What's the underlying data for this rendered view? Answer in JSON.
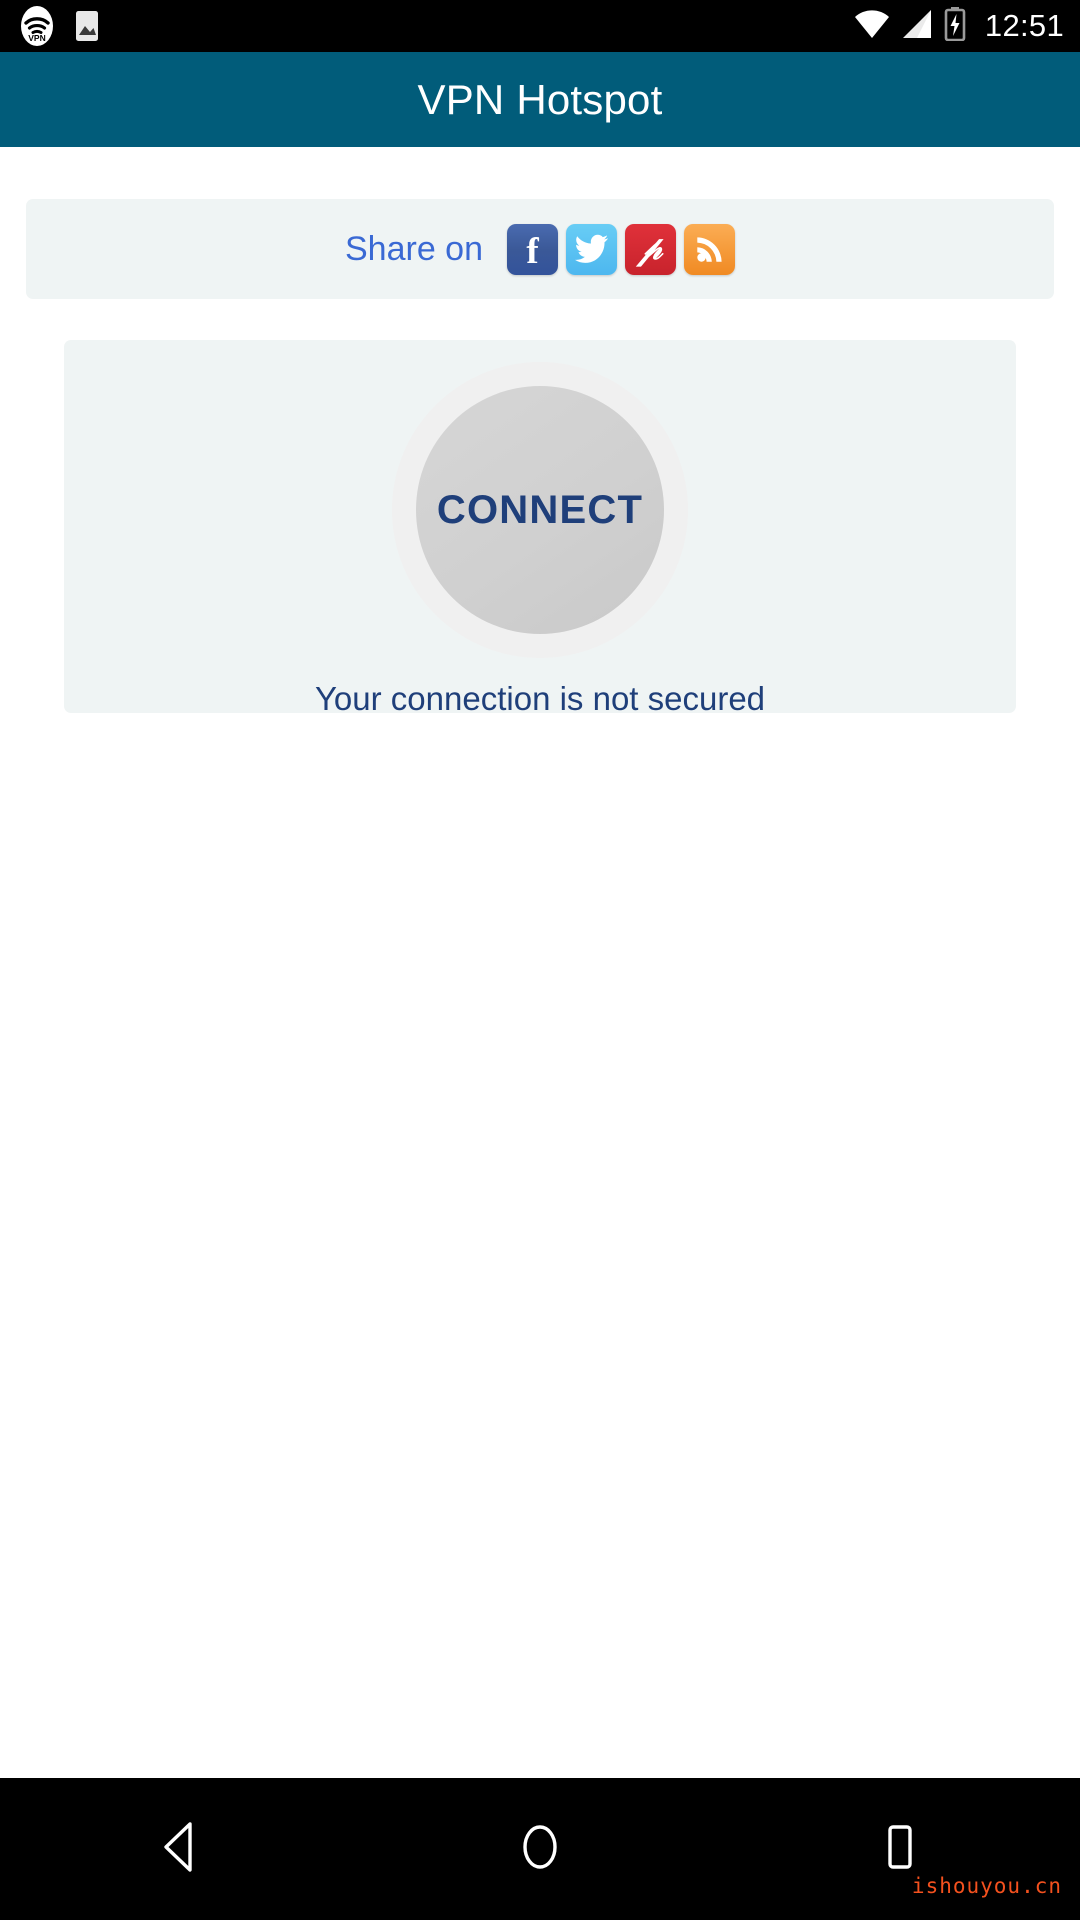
{
  "statusbar": {
    "time": "12:51",
    "icons": {
      "vpn": "vpn-key-icon",
      "screenshot": "image-icon",
      "wifi": "wifi-icon",
      "signal": "cellular-signal-icon",
      "battery": "battery-charging-icon"
    }
  },
  "appbar": {
    "title": "VPN Hotspot",
    "background_color": "#015c7a",
    "title_color": "#ffffff"
  },
  "share": {
    "label": "Share on",
    "label_color": "#3a69d4",
    "card_color": "#eff4f4",
    "buttons": [
      {
        "name": "facebook",
        "glyph": "f",
        "color": "#3b5998"
      },
      {
        "name": "twitter",
        "glyph": "bird",
        "color": "#4db7ef"
      },
      {
        "name": "pinterest",
        "glyph": "P",
        "color": "#c8232c"
      },
      {
        "name": "rss",
        "glyph": "rss-waves",
        "color": "#f08a23"
      }
    ]
  },
  "connect": {
    "button_label": "CONNECT",
    "status_text": "Your connection is not secured",
    "text_color": "#1f3f7a",
    "button_color": "#d0d0d0",
    "ring_color": "#f0f0f0",
    "card_color": "#eff4f4"
  },
  "navbar": {
    "back": "back-triangle",
    "home": "home-circle",
    "recents": "recents-square",
    "background_color": "#000000"
  },
  "watermark": {
    "text": "ishouyou.cn",
    "color": "#f4511e"
  }
}
